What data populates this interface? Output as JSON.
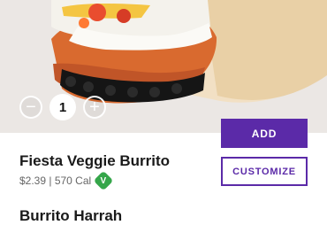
{
  "item": {
    "quantity": "1",
    "name": "Fiesta Veggie Burrito",
    "meta": "$2.39 | 570 Cal",
    "veg_badge": "V"
  },
  "actions": {
    "add_label": "ADD",
    "customize_label": "CUSTOMIZE"
  },
  "stepper": {
    "decrement_icon": "minus-icon",
    "increment_icon": "plus-icon"
  },
  "next_item": {
    "name": "Burrito Harrah"
  },
  "colors": {
    "accent": "#5b2aa8",
    "veg": "#35a64a"
  }
}
